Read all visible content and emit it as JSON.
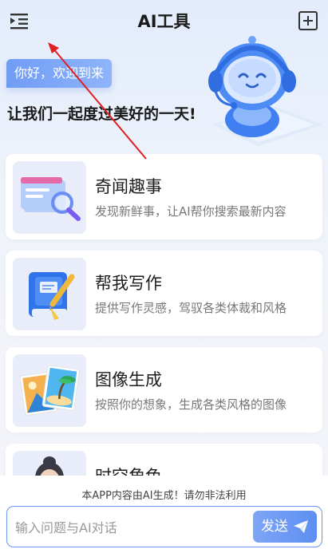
{
  "header": {
    "title": "AI工具",
    "menu_icon": "menu-indent-icon",
    "add_icon": "plus-square-icon"
  },
  "hero": {
    "greeting": "你好，欢迎到来",
    "tagline": "让我们一起度过美好的一天!"
  },
  "cards": [
    {
      "title": "奇闻趣事",
      "desc": "发现新鲜事，让AI帮你搜索最新内容",
      "icon": "magnifier-document-icon"
    },
    {
      "title": "帮我写作",
      "desc": "提供写作灵感，驾驭各类体裁和风格",
      "icon": "book-pencil-icon"
    },
    {
      "title": "图像生成",
      "desc": "按照你的想象，生成各类风格的图像",
      "icon": "photos-icon"
    },
    {
      "title": "时空角色",
      "desc": "",
      "icon": "character-avatar-icon"
    }
  ],
  "footer": {
    "disclaimer": "本APP内容由AI生成！请勿非法利用",
    "input_placeholder": "输入问题与AI对话",
    "send_label": "发送"
  },
  "colors": {
    "accent": "#5d8ef1",
    "annotation_arrow": "#e02020"
  }
}
